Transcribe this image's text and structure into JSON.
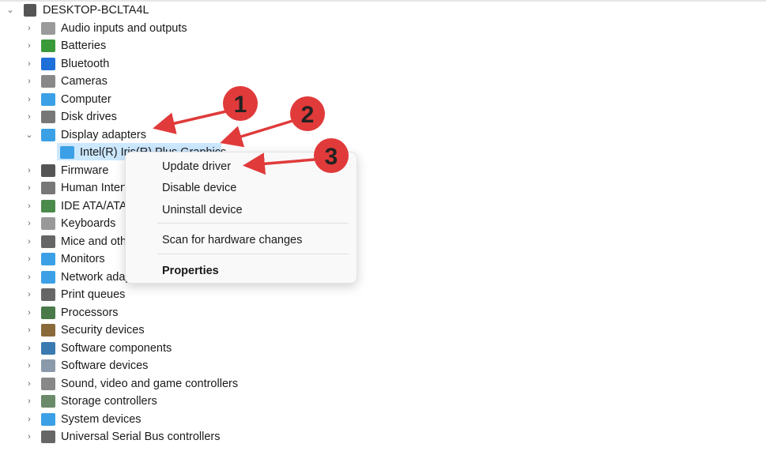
{
  "tree": {
    "root": "DESKTOP-BCLTA4L",
    "categories": [
      {
        "label": "Audio inputs and outputs",
        "icon": "speaker-icon",
        "color": "#9a9a9a"
      },
      {
        "label": "Batteries",
        "icon": "battery-icon",
        "color": "#3a9a3a"
      },
      {
        "label": "Bluetooth",
        "icon": "bluetooth-icon",
        "color": "#1e6fd9"
      },
      {
        "label": "Cameras",
        "icon": "camera-icon",
        "color": "#888888"
      },
      {
        "label": "Computer",
        "icon": "computer-icon",
        "color": "#3ba0e6"
      },
      {
        "label": "Disk drives",
        "icon": "disk-drive-icon",
        "color": "#777777"
      },
      {
        "label": "Display adapters",
        "icon": "display-adapter-icon",
        "color": "#3ba0e6",
        "expanded": true,
        "children": [
          "Intel(R) Iris(R) Plus Graphics"
        ]
      },
      {
        "label": "Firmware",
        "icon": "firmware-icon",
        "color": "#555555"
      },
      {
        "label": "Human Interface Devices",
        "icon": "hid-icon",
        "color": "#777777"
      },
      {
        "label": "IDE ATA/ATAPI controllers",
        "icon": "ide-controller-icon",
        "color": "#4a8a4a"
      },
      {
        "label": "Keyboards",
        "icon": "keyboard-icon",
        "color": "#999999"
      },
      {
        "label": "Mice and other pointing devices",
        "icon": "mouse-icon",
        "color": "#666666"
      },
      {
        "label": "Monitors",
        "icon": "monitor-icon",
        "color": "#3ba0e6"
      },
      {
        "label": "Network adapters",
        "icon": "network-adapter-icon",
        "color": "#3ba0e6"
      },
      {
        "label": "Print queues",
        "icon": "printer-icon",
        "color": "#666666"
      },
      {
        "label": "Processors",
        "icon": "processor-icon",
        "color": "#4a7a4a"
      },
      {
        "label": "Security devices",
        "icon": "security-device-icon",
        "color": "#8a6a3a"
      },
      {
        "label": "Software components",
        "icon": "software-component-icon",
        "color": "#3a7ab0"
      },
      {
        "label": "Software devices",
        "icon": "software-device-icon",
        "color": "#8a9aaa"
      },
      {
        "label": "Sound, video and game controllers",
        "icon": "sound-icon",
        "color": "#888888"
      },
      {
        "label": "Storage controllers",
        "icon": "storage-controller-icon",
        "color": "#6a8a6a"
      },
      {
        "label": "System devices",
        "icon": "system-device-icon",
        "color": "#3ba0e6"
      },
      {
        "label": "Universal Serial Bus controllers",
        "icon": "usb-icon",
        "color": "#666666"
      }
    ]
  },
  "context_menu": {
    "items": [
      "Update driver",
      "Disable device",
      "Uninstall device",
      "Scan for hardware changes",
      "Properties"
    ]
  },
  "annotations": {
    "labels": [
      "1",
      "2",
      "3"
    ],
    "color": "#e03a3a"
  }
}
